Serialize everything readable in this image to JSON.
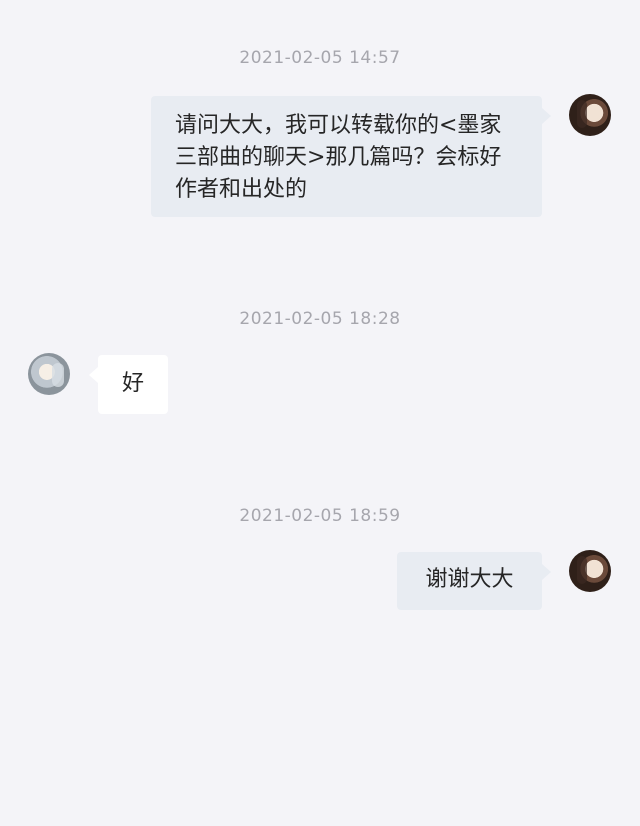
{
  "colors": {
    "background": "#f4f4f8",
    "self_bubble": "#e8ecf2",
    "other_bubble": "#ffffff",
    "timestamp_text": "#a6a6ad",
    "message_text": "#262626"
  },
  "messages": [
    {
      "timestamp": "2021-02-05 14:57",
      "sender": "self",
      "avatar_icon": "avatar-self",
      "text": "请问大大，我可以转载你的<墨家三部曲的聊天>那几篇吗？会标好作者和出处的"
    },
    {
      "timestamp": "2021-02-05 18:28",
      "sender": "other",
      "avatar_icon": "avatar-other",
      "text": "好"
    },
    {
      "timestamp": "2021-02-05 18:59",
      "sender": "self",
      "avatar_icon": "avatar-self",
      "text": "谢谢大大"
    }
  ]
}
